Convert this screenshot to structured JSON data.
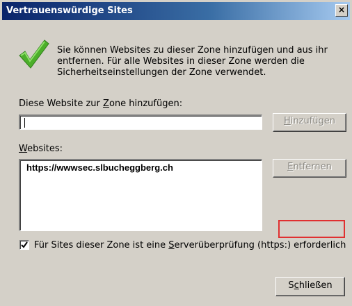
{
  "window": {
    "title": "Vertrauenswürdige Sites",
    "close_glyph": "×"
  },
  "icons": {
    "info": "checkmark-icon",
    "close": "close-icon",
    "checkbox": "check-icon"
  },
  "colors": {
    "title_start": "#0a246a",
    "title_end": "#a6caf0",
    "dialog_bg": "#d4d0c8",
    "check_green": "#4caf2a",
    "highlight_red": "#e03030"
  },
  "info_text": "Sie können Websites zu dieser Zone hinzufügen und aus ihr entfernen. Für alle Websites in dieser Zone werden die Sicherheitseinstellungen der Zone verwendet.",
  "add_section": {
    "label_pre": "Diese Website zur ",
    "label_key": "Z",
    "label_post": "one hinzufügen:",
    "input_value": "",
    "button_key": "H",
    "button_rest": "inzufügen"
  },
  "websites": {
    "label_key": "W",
    "label_rest": "ebsites:",
    "items": [
      "https://wwwsec.slbucheggberg.ch"
    ],
    "remove_key": "E",
    "remove_rest": "ntfernen"
  },
  "https_check": {
    "checked": true,
    "label_pre": "Für Sites dieser Zone ist eine ",
    "label_key": "S",
    "label_post": "erverüberprüfung (https:) erforderlich"
  },
  "footer": {
    "close_pre": "S",
    "close_key": "c",
    "close_post": "hließen"
  }
}
